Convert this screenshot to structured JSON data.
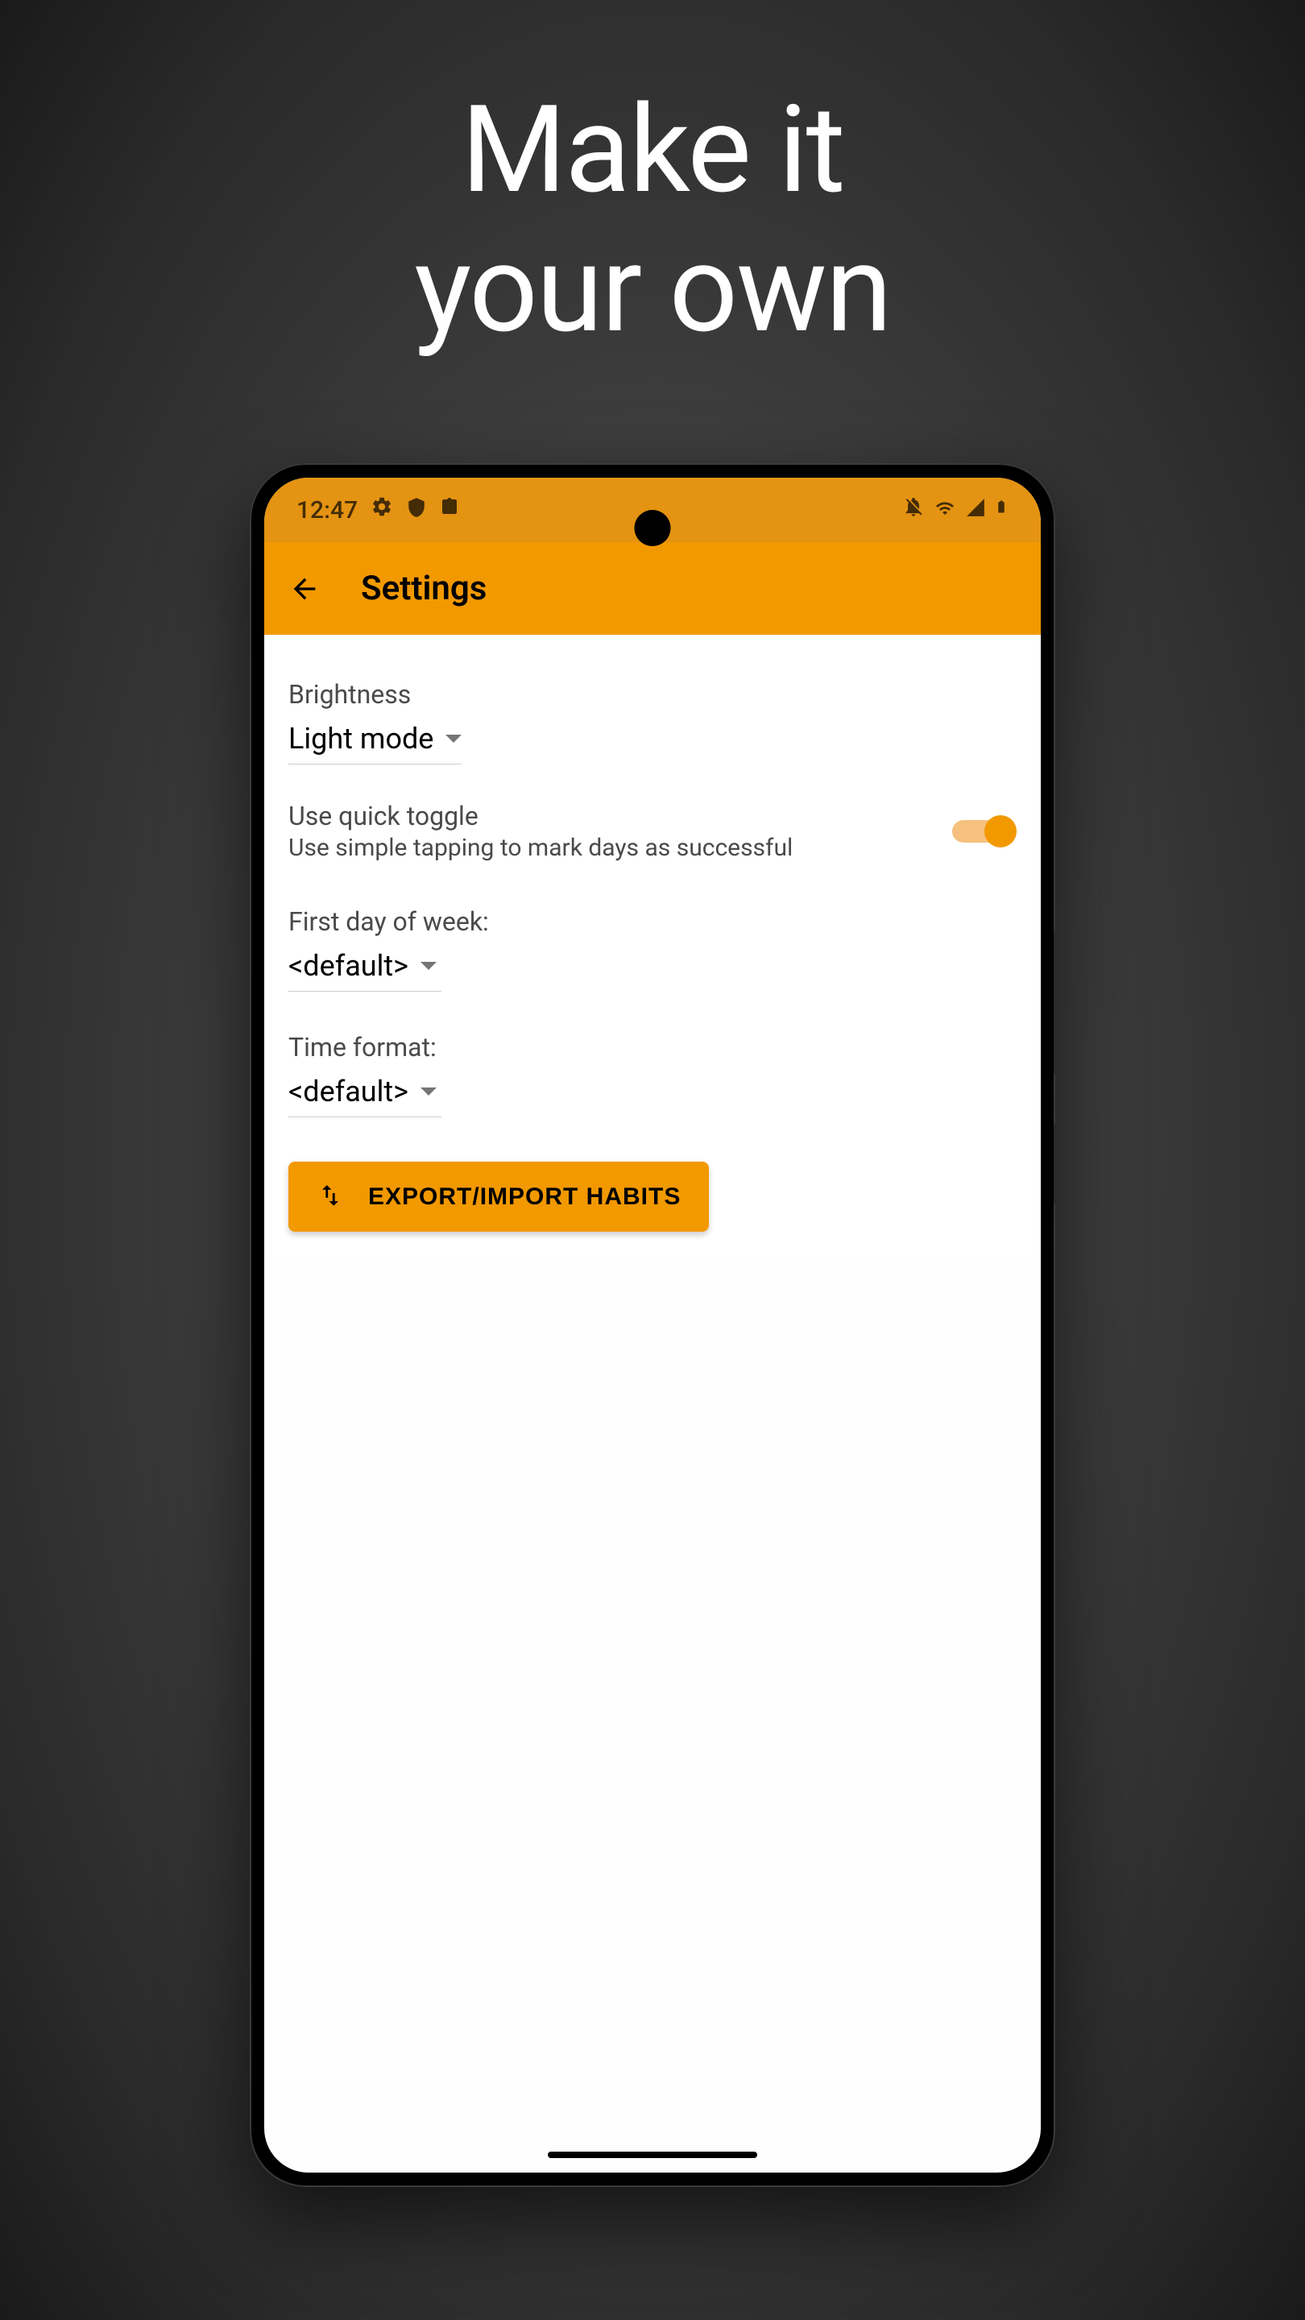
{
  "promo": {
    "title_line1": "Make it",
    "title_line2": "your own"
  },
  "statusbar": {
    "time": "12:47"
  },
  "appbar": {
    "title": "Settings"
  },
  "settings": {
    "brightness": {
      "label": "Brightness",
      "value": "Light mode"
    },
    "quick_toggle": {
      "title": "Use quick toggle",
      "subtitle": "Use simple tapping to mark days as successful",
      "enabled": true
    },
    "first_day": {
      "label": "First day of week:",
      "value": "<default>"
    },
    "time_format": {
      "label": "Time format:",
      "value": "<default>"
    },
    "export_button": {
      "label": "EXPORT/IMPORT HABITS"
    }
  },
  "colors": {
    "accent": "#F29900",
    "accent_dark": "#E49312"
  }
}
